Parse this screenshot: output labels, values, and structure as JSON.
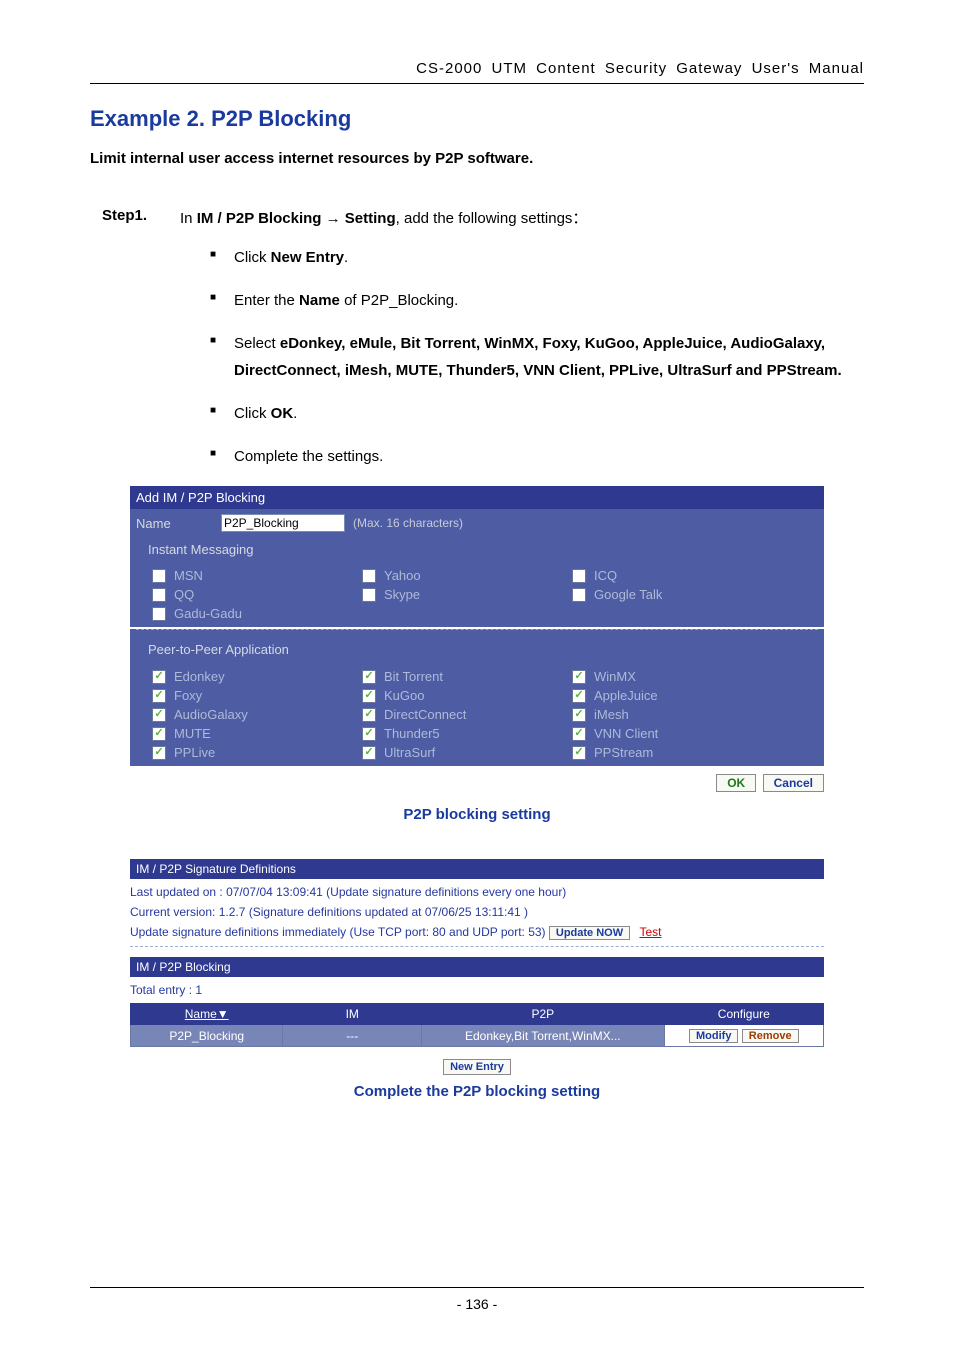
{
  "header": "CS-2000 UTM Content Security Gateway User's Manual",
  "title": "Example 2. P2P Blocking",
  "lead": "Limit internal user access internet resources by P2P software.",
  "step_label": "Step1.",
  "step_text_prefix": "In ",
  "step_text_bold1": "IM / P2P Blocking",
  "step_text_arrow": " → ",
  "step_text_bold2": "Setting",
  "step_text_suffix": ", add the following settings：",
  "bullets": {
    "b1a": "Click ",
    "b1b": "New Entry",
    "b1c": ".",
    "b2a": "Enter the ",
    "b2b": "Name",
    "b2c": " of P2P_Blocking.",
    "b3a": "Select ",
    "b3b": "eDonkey, eMule, Bit Torrent, WinMX, Foxy, KuGoo, AppleJuice, AudioGalaxy, DirectConnect, iMesh, MUTE, Thunder5, VNN Client, PPLive, UltraSurf and PPStream.",
    "b4a": "Click ",
    "b4b": "OK",
    "b4c": ".",
    "b5": "Complete the settings."
  },
  "shot1": {
    "title": "Add IM / P2P Blocking",
    "name_label": "Name",
    "name_value": "P2P_Blocking",
    "name_hint": "(Max. 16 characters)",
    "im_head": "Instant Messaging",
    "p2p_head": "Peer-to-Peer Application",
    "im_items": [
      [
        "MSN",
        "Yahoo",
        "ICQ"
      ],
      [
        "QQ",
        "Skype",
        "Google Talk"
      ],
      [
        "Gadu-Gadu",
        "",
        ""
      ]
    ],
    "p2p_items": [
      [
        "Edonkey",
        "Bit Torrent",
        "WinMX"
      ],
      [
        "Foxy",
        "KuGoo",
        "AppleJuice"
      ],
      [
        "AudioGalaxy",
        "DirectConnect",
        "iMesh"
      ],
      [
        "MUTE",
        "Thunder5",
        "VNN Client"
      ],
      [
        "PPLive",
        "UltraSurf",
        "PPStream"
      ]
    ],
    "ok": "OK",
    "cancel": "Cancel"
  },
  "caption1": "P2P blocking setting",
  "shot2": {
    "sig_title": "IM / P2P Signature Definitions",
    "sig_line1": "Last updated on : 07/07/04 13:09:41  (Update signature definitions every one hour)",
    "sig_line2": "Current version: 1.2.7  (Signature definitions updated at 07/06/25 13:11:41 )",
    "sig_line3": "Update signature definitions immediately (Use TCP port: 80 and UDP port: 53)",
    "update_now": "Update NOW",
    "test": "Test",
    "block_title": "IM / P2P Blocking",
    "total_entry": "Total entry : 1",
    "cols": {
      "name": "Name",
      "im": "IM",
      "p2p": "P2P",
      "conf": "Configure"
    },
    "row": {
      "name": "P2P_Blocking",
      "im": "---",
      "p2p": "Edonkey,Bit Torrent,WinMX..."
    },
    "modify": "Modify",
    "remove": "Remove",
    "new_entry": "New Entry"
  },
  "caption2": "Complete the P2P blocking setting",
  "page_no": "- 136 -"
}
